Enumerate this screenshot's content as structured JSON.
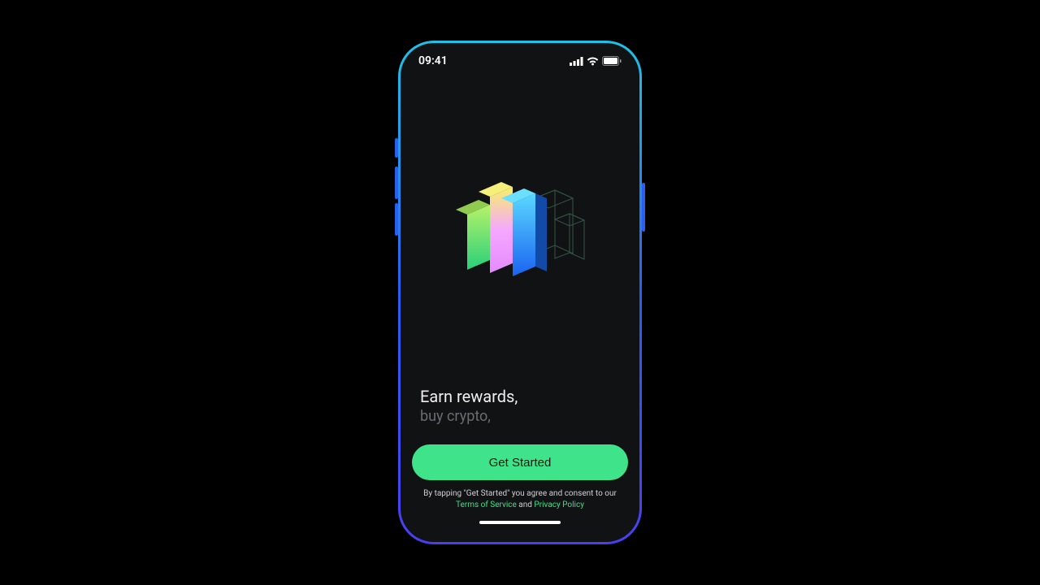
{
  "statusbar": {
    "time": "09:41"
  },
  "onboarding": {
    "headline_primary": "Earn rewards,",
    "headline_secondary": "buy crypto,",
    "cta_label": "Get Started",
    "legal_prefix": "By tapping \"Get Started\" you agree and consent to our",
    "terms_label": "Terms of Service",
    "conjunction": "and",
    "privacy_label": "Privacy Policy"
  }
}
